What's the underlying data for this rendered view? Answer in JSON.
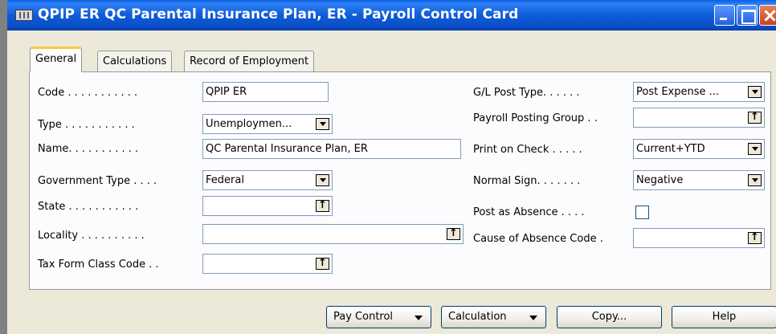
{
  "window": {
    "title": "QPIP ER QC Parental Insurance Plan, ER - Payroll Control Card",
    "icon": "table-icon"
  },
  "tabs": [
    {
      "label": "General",
      "active": true
    },
    {
      "label": "Calculations",
      "active": false
    },
    {
      "label": "Record of Employment",
      "active": false
    }
  ],
  "left_fields": {
    "code": {
      "label": "Code . . . . . . . . . . .",
      "value": "QPIP ER"
    },
    "type": {
      "label": "Type . . . . . . . . . . .",
      "value": "Unemploymen..."
    },
    "name": {
      "label": "Name. . . . . . . . . . .",
      "value": "QC Parental Insurance Plan, ER"
    },
    "government_type": {
      "label": "Government Type . . . .",
      "value": "Federal"
    },
    "state": {
      "label": "State . . . . . . . . . . .",
      "value": ""
    },
    "locality": {
      "label": "Locality . . . . . . . . . .",
      "value": ""
    },
    "tax_form_class_code": {
      "label": "Tax Form Class Code . .",
      "value": ""
    }
  },
  "right_fields": {
    "gl_post_type": {
      "label": "G/L Post Type. . . . . .",
      "value": "Post Expense ..."
    },
    "payroll_posting_group": {
      "label": "Payroll Posting Group . .",
      "value": ""
    },
    "print_on_check": {
      "label": "Print on Check . . . . .",
      "value": "Current+YTD"
    },
    "normal_sign": {
      "label": "Normal Sign. . . . . . .",
      "value": "Negative"
    },
    "post_as_absence": {
      "label": "Post as Absence . . . .",
      "checked": false
    },
    "cause_of_absence_code": {
      "label": "Cause of Absence Code .",
      "value": ""
    }
  },
  "buttons": {
    "pay_control": "Pay Control",
    "calculation": "Calculation",
    "copy": "Copy...",
    "help": "Help"
  }
}
